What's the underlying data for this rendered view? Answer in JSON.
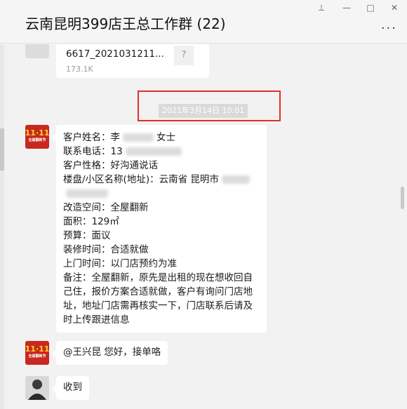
{
  "window": {
    "title": "云南昆明399店王总工作群 (22)",
    "controls": [
      "⊥",
      "—",
      "□",
      "✕"
    ],
    "more": "···"
  },
  "messages": {
    "file": {
      "name": "6617_2021031211...",
      "size": "173.1K",
      "icon": "?"
    },
    "timestamp": "2021年3月14日 10:01",
    "order": {
      "lines": [
        "客户姓名：李",
        "女士",
        "联系电话：13",
        "客户性格：好沟通说话",
        "楼盘/小区名称(地址)：云南省 昆明市",
        "改造空间：全屋翻新",
        "面积：129㎡",
        "预算：面议",
        "装修时间：合适就做",
        "上门时间：以门店预约为准",
        "备注：全屋翻新，原先是出租的现在想收回自己住，报价方案合适就做，客户有询问门店地址，地址门店需再核实一下，门店联系后请及时上传跟进信息"
      ]
    },
    "reply": "@王兴昆 您好，接单咯",
    "ack": "收到"
  },
  "avatars": {
    "logo_text": "11·11",
    "logo_sub": "全屋翻新节"
  }
}
